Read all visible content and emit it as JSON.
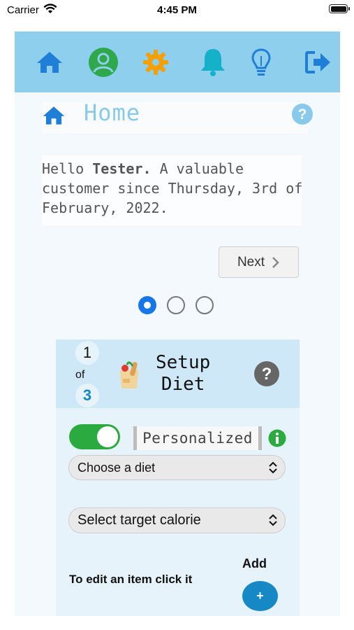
{
  "status_bar": {
    "carrier": "Carrier",
    "time": "4:45 PM"
  },
  "navbar": {
    "items": [
      {
        "icon": "home-icon",
        "color": "#1f7fd6"
      },
      {
        "icon": "profile-icon",
        "color": "#2ea84a"
      },
      {
        "icon": "gear-icon",
        "color": "#f5a000"
      },
      {
        "icon": "bell-icon",
        "color": "#14b1c9"
      },
      {
        "icon": "lightbulb-icon",
        "color": "#1f7fd6"
      },
      {
        "icon": "logout-icon",
        "color": "#1f7fd6"
      }
    ]
  },
  "header": {
    "title": "Home"
  },
  "greeting": {
    "prefix": "Hello ",
    "name": "Tester.",
    "suffix": " A valuable customer since Thursday, 3rd of February, 2022."
  },
  "pager": {
    "next_label": "Next",
    "active_index": 0,
    "count": 3
  },
  "setup_card": {
    "step_current": "1",
    "step_of": "of",
    "step_total": "3",
    "title_line1": "Setup",
    "title_line2": "Diet",
    "toggle_on": true,
    "personalized_label": "Personalized",
    "diet_select": "Choose a diet",
    "calorie_select": "Select target calorie",
    "edit_hint": "To edit an item click it",
    "add_label": "Add",
    "add_button": "+"
  },
  "colors": {
    "accent": "#8ecfee",
    "primary": "#1688c6",
    "toggle": "#2bab3f"
  }
}
